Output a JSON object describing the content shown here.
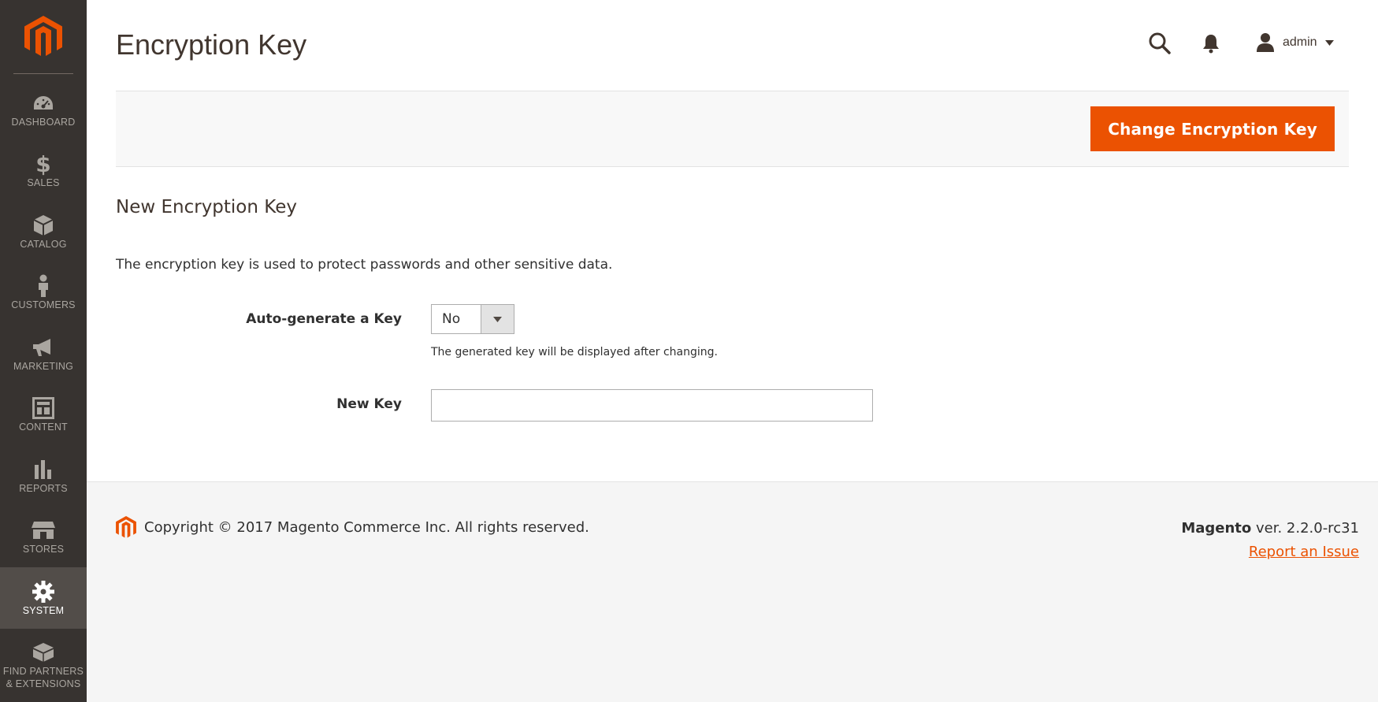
{
  "brand": {
    "name": "Magento",
    "accent_color": "#eb5202",
    "sidebar_bg": "#373330",
    "sidebar_active_bg": "#524d49"
  },
  "sidebar": {
    "items": [
      {
        "label": "DASHBOARD",
        "icon": "dashboard-gauge-icon",
        "active": false
      },
      {
        "label": "SALES",
        "icon": "dollar-icon",
        "active": false
      },
      {
        "label": "CATALOG",
        "icon": "box-icon",
        "active": false
      },
      {
        "label": "CUSTOMERS",
        "icon": "person-icon",
        "active": false
      },
      {
        "label": "MARKETING",
        "icon": "megaphone-icon",
        "active": false
      },
      {
        "label": "CONTENT",
        "icon": "layout-icon",
        "active": false
      },
      {
        "label": "REPORTS",
        "icon": "bar-chart-icon",
        "active": false
      },
      {
        "label": "STORES",
        "icon": "storefront-icon",
        "active": false
      },
      {
        "label": "SYSTEM",
        "icon": "gear-icon",
        "active": true
      },
      {
        "label": "FIND PARTNERS\n& EXTENSIONS",
        "icon": "blocks-icon",
        "active": false
      }
    ]
  },
  "header": {
    "title": "Encryption Key",
    "user_name": "admin"
  },
  "actions": {
    "primary_label": "Change Encryption Key"
  },
  "form": {
    "section_title": "New Encryption Key",
    "intro": "The encryption key is used to protect passwords and other sensitive data.",
    "auto_generate": {
      "label": "Auto-generate a Key",
      "value": "No",
      "note": "The generated key will be displayed after changing."
    },
    "new_key": {
      "label": "New Key",
      "value": ""
    }
  },
  "footer": {
    "copyright": "Copyright © 2017 Magento Commerce Inc. All rights reserved.",
    "product": "Magento",
    "version": " ver. 2.2.0-rc31",
    "report_link": "Report an Issue"
  }
}
